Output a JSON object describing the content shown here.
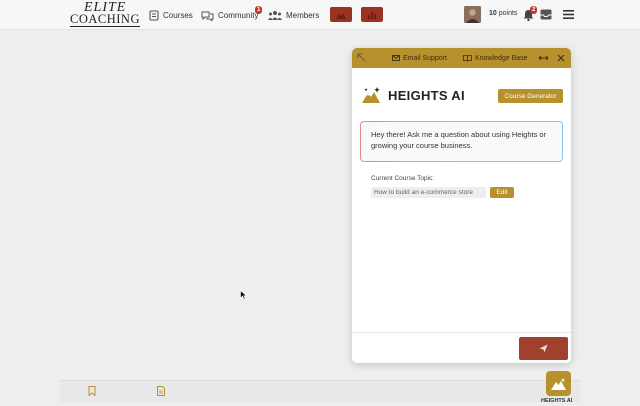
{
  "header": {
    "logo_line1": "ELITE",
    "logo_line2": "COACHING",
    "nav": {
      "courses": "Courses",
      "community": "Community",
      "community_badge": "1",
      "members": "Members"
    },
    "points_value": "10",
    "points_label": "points",
    "notification_badge": "2"
  },
  "assistant": {
    "header_links": {
      "email_support": "Email Support",
      "knowledge_base": "Knowledge Base"
    },
    "title": "HEIGHTS AI",
    "course_generator_label": "Course Generator",
    "greeting": "Hey there! Ask me a question about using Heights or growing your course business.",
    "topic_label": "Current Course Topic:",
    "topic_value": "How to build an e-commerce store",
    "edit_label": "Edit",
    "launcher_label": "HEIGHTS AI"
  },
  "colors": {
    "accent_gold": "#b8912f",
    "accent_red": "#9b3324",
    "send_red": "#a0412d",
    "badge_red": "#c0392b"
  }
}
